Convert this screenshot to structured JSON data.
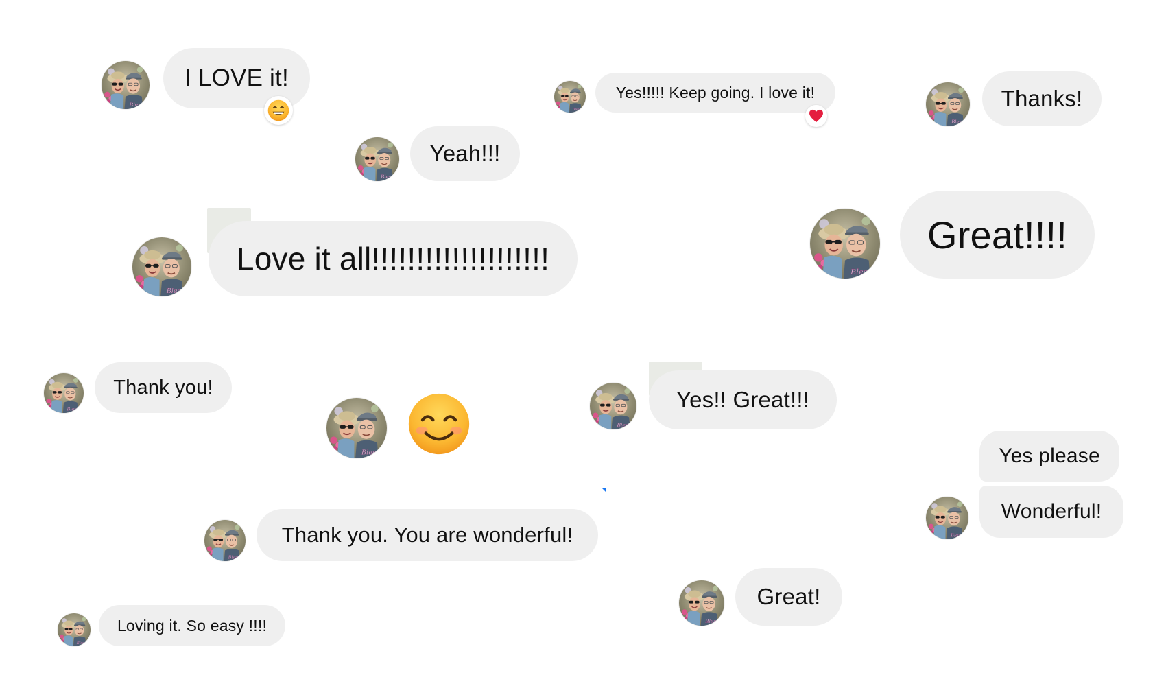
{
  "colors": {
    "bubble_background": "#efefef",
    "text": "#111111",
    "heart": "#e41e3f",
    "emoji_yellow": "#fbb731",
    "marker_blue": "#1877f2"
  },
  "avatar": {
    "icon": "couple-selfie-avatar",
    "signature": "Blessed"
  },
  "messages": [
    {
      "text": "I LOVE it!",
      "reaction": "grinning-face-emoji"
    },
    {
      "text": "Yes!!!!!  Keep going. I love it!",
      "reaction": "red-heart-emoji"
    },
    {
      "text": "Thanks!"
    },
    {
      "text": "Yeah!!!"
    },
    {
      "text": "Love it all!!!!!!!!!!!!!!!!!!!!"
    },
    {
      "text": "Great!!!!"
    },
    {
      "text": "Thank you!"
    },
    {
      "emoji": "smiling-face-with-smiling-eyes-emoji"
    },
    {
      "text": "Yes!!  Great!!!"
    },
    {
      "text": "Yes please"
    },
    {
      "text": "Wonderful!"
    },
    {
      "text": "Thank you.  You are wonderful!"
    },
    {
      "text": "Great!"
    },
    {
      "text": "Loving it.  So easy !!!!"
    }
  ]
}
